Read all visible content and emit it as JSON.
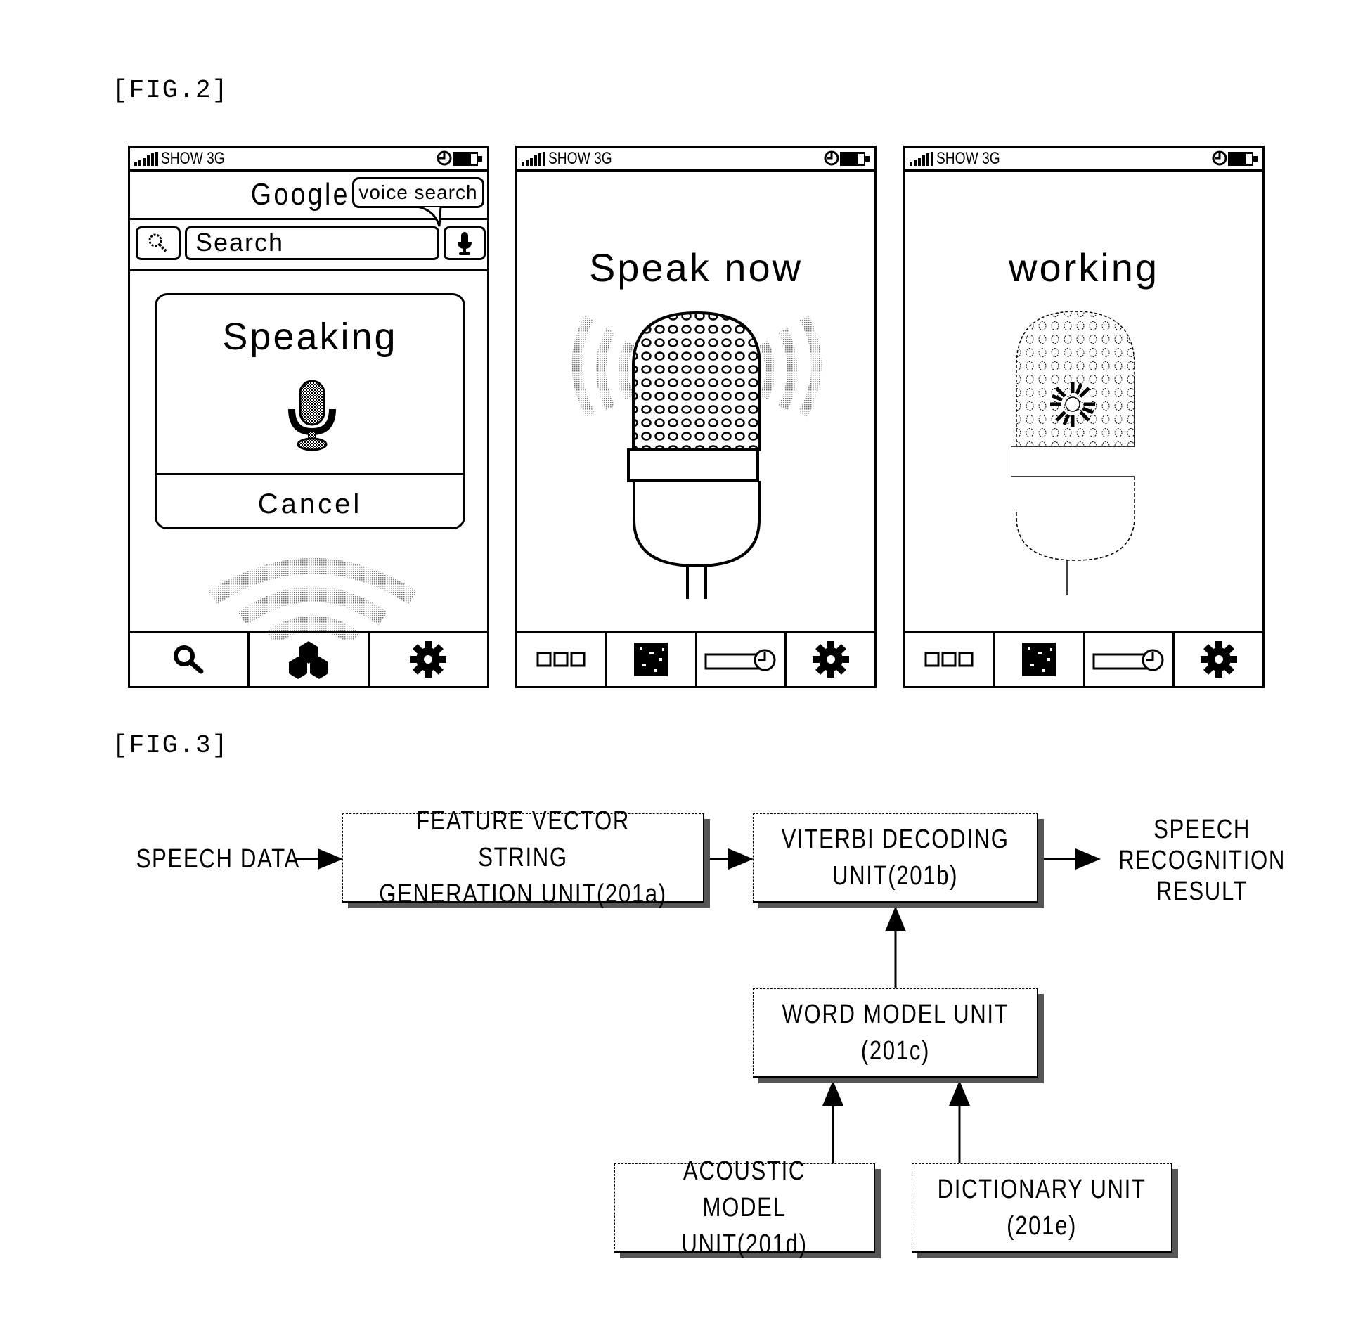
{
  "fig2": {
    "label": "[FIG.2]",
    "phones": [
      {
        "status": {
          "carrier": "SHOW 3G",
          "icons": [
            "signal-icon",
            "clock-icon",
            "battery-icon"
          ]
        },
        "header": {
          "logo": "Google",
          "tooltip": "voice search"
        },
        "search": {
          "placeholder": "Search",
          "left_icon": "search-icon",
          "right_icon": "microphone-icon"
        },
        "dialog": {
          "title": "Speaking",
          "icon": "microphone-icon",
          "cancel_label": "Cancel"
        },
        "animation_icon": "sound-wave-icon",
        "bottom_bar": [
          "search-icon",
          "apps-cluster-icon",
          "gear-icon"
        ]
      },
      {
        "status": {
          "carrier": "SHOW 3G",
          "icons": [
            "signal-icon",
            "clock-icon",
            "battery-icon"
          ]
        },
        "title": "Speak now",
        "icon": "microphone-icon",
        "bottom_bar": [
          "grid-dots-icon",
          "qr-code-icon",
          "timer-slider-icon",
          "gear-icon"
        ]
      },
      {
        "status": {
          "carrier": "SHOW 3G",
          "icons": [
            "signal-icon",
            "clock-icon",
            "battery-icon"
          ]
        },
        "title": "working",
        "icon": "microphone-processing-icon",
        "bottom_bar": [
          "grid-dots-icon",
          "qr-code-icon",
          "timer-slider-icon",
          "gear-icon"
        ]
      }
    ]
  },
  "fig3": {
    "label": "[FIG.3]",
    "input_label": "SPEECH DATA",
    "output_label": "SPEECH\nRECOGNITION\nRESULT",
    "boxes": {
      "feature": "FEATURE VECTOR STRING\nGENERATION UNIT(201a)",
      "viterbi": "VITERBI DECODING\nUNIT(201b)",
      "word_model": "WORD MODEL UNIT\n(201c)",
      "acoustic": "ACOUSTIC MODEL\nUNIT(201d)",
      "dictionary": "DICTIONARY UNIT\n(201e)"
    },
    "edges": [
      [
        "SPEECH DATA",
        "feature"
      ],
      [
        "feature",
        "viterbi"
      ],
      [
        "viterbi",
        "SPEECH RECOGNITION RESULT"
      ],
      [
        "word_model",
        "viterbi"
      ],
      [
        "acoustic",
        "word_model"
      ],
      [
        "dictionary",
        "word_model"
      ]
    ]
  }
}
